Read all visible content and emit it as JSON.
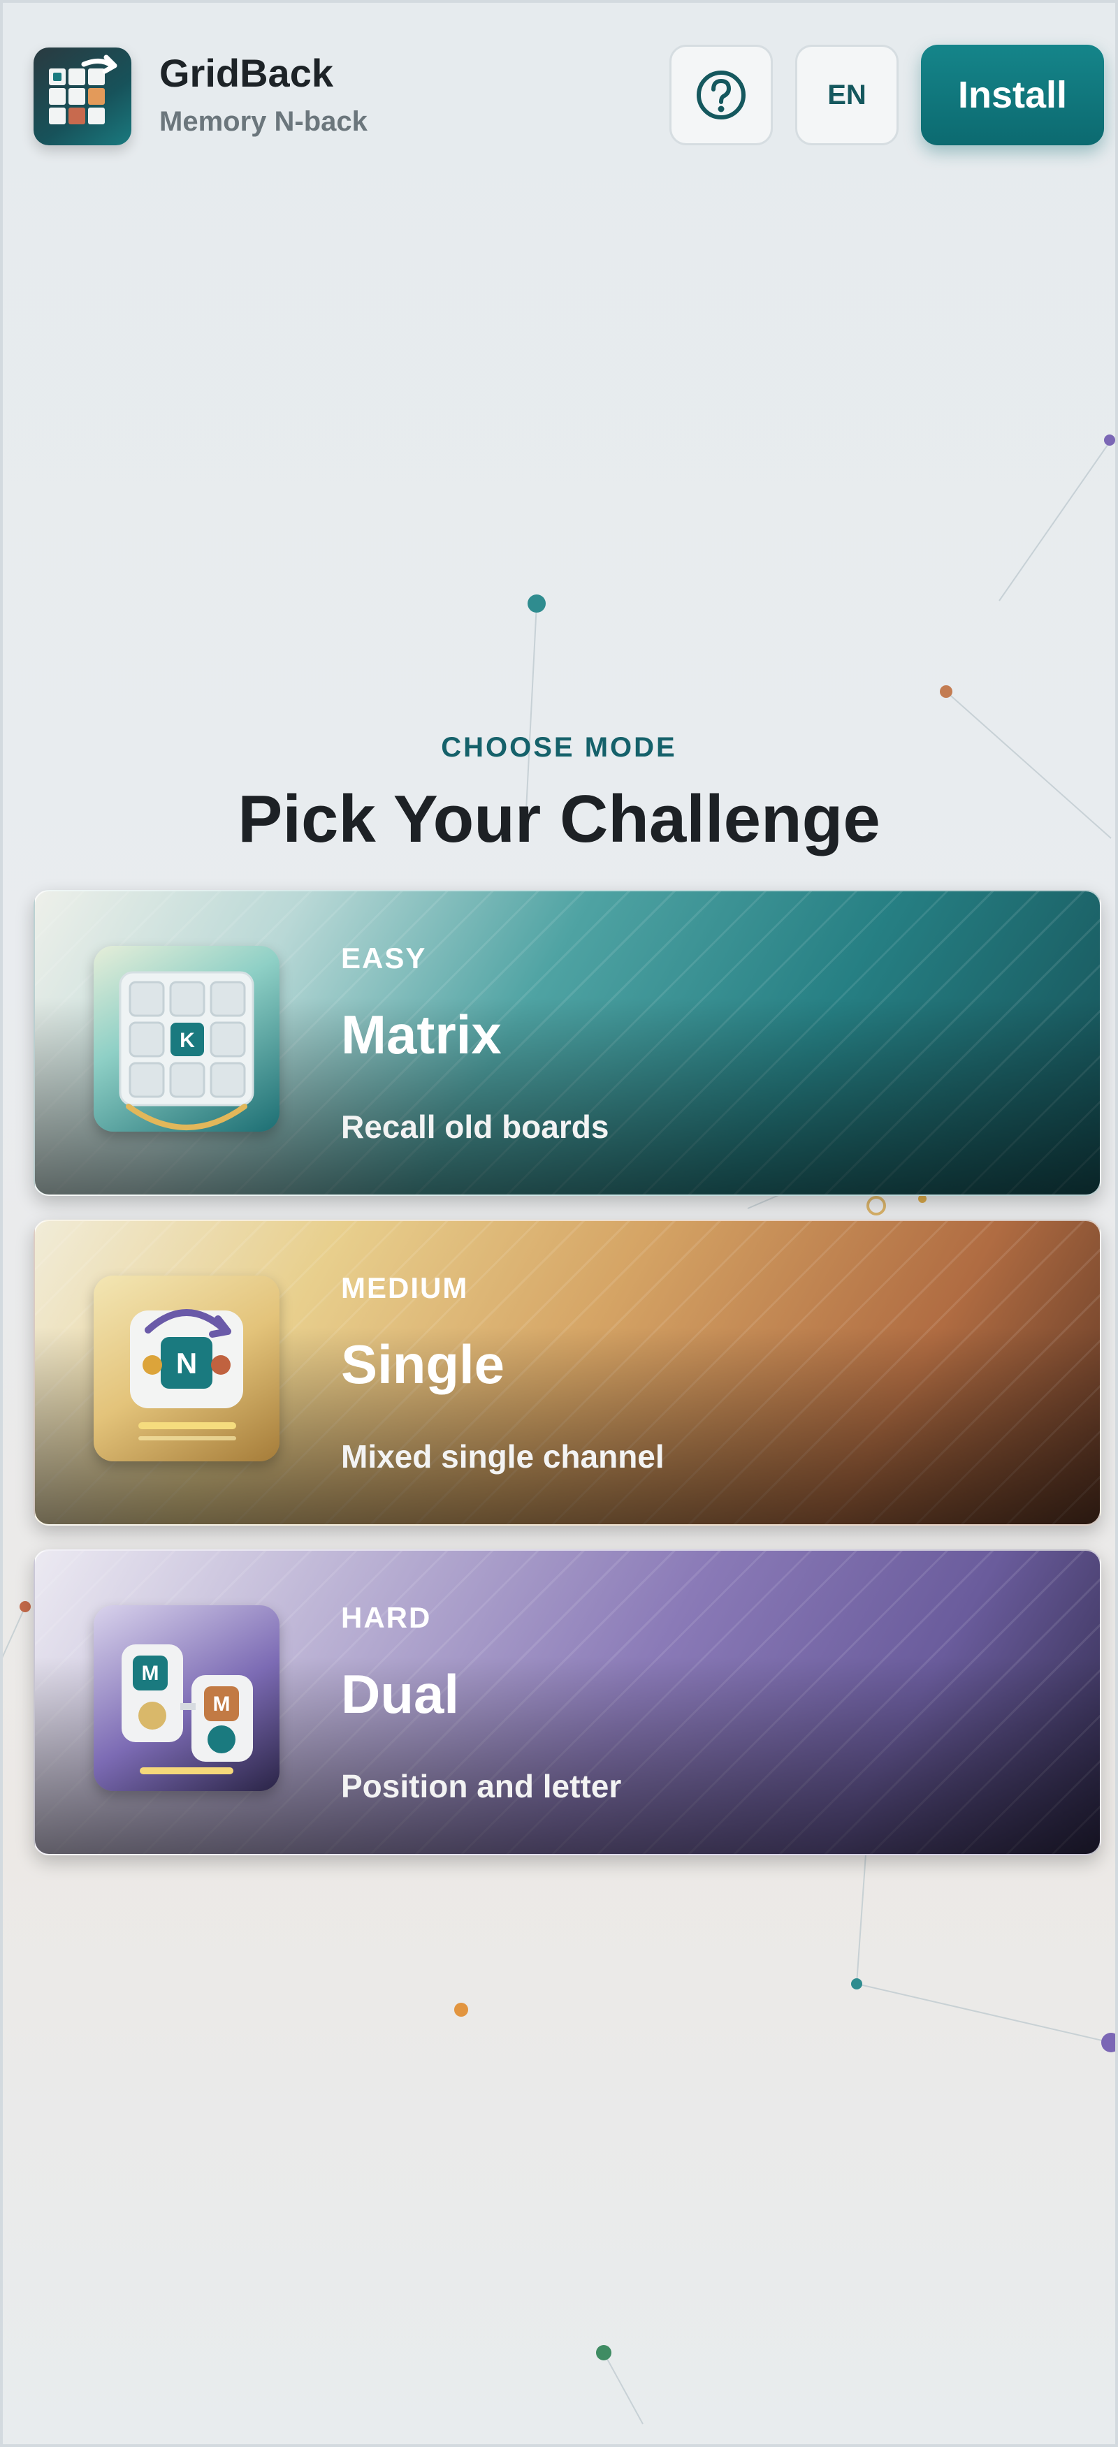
{
  "app": {
    "name": "GridBack",
    "subtitle": "Memory N-back"
  },
  "header": {
    "help_icon": "question-circle-icon",
    "lang_label": "EN",
    "install_label": "Install"
  },
  "section": {
    "eyebrow": "CHOOSE MODE",
    "title": "Pick Your Challenge"
  },
  "modes": [
    {
      "level": "EASY",
      "name": "Matrix",
      "desc": "Recall old boards",
      "icon_letter": "K",
      "accent": "#1a7a7f"
    },
    {
      "level": "MEDIUM",
      "name": "Single",
      "desc": "Mixed single channel",
      "icon_letter": "N",
      "accent": "#c27a44"
    },
    {
      "level": "HARD",
      "name": "Dual",
      "desc": "Position and letter",
      "icon_letters": [
        "M",
        "M"
      ],
      "accent": "#6a5c9c"
    }
  ],
  "colors": {
    "brand": "#0c6a70",
    "background": "#e8ecee"
  }
}
